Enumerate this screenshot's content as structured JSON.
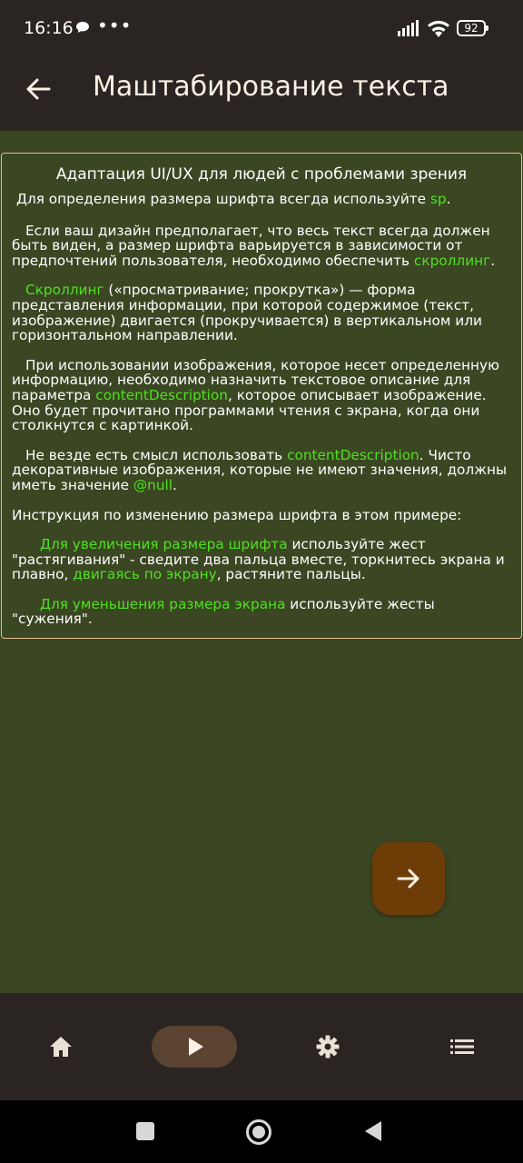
{
  "status_bar": {
    "time": "16:16",
    "dots": "•••",
    "battery": "92"
  },
  "app_bar": {
    "title": "Маштабирование текста"
  },
  "card": {
    "title": "Адаптация UI/UX для людей с проблемами зрения",
    "p1": {
      "text": "Для определения размера шрифта всегда используйте ",
      "hl": "sp",
      "end": "."
    },
    "p2": {
      "text": "Если ваш дизайн предполагает, что весь текст всегда должен быть виден, а размер шрифта варьируется в зависимости от предпочтений пользователя, необходимо обеспечить ",
      "hl": "скроллинг",
      "end": "."
    },
    "p3": {
      "hl": "Скроллинг",
      "text": " («просматривание; прокрутка») — форма представления информации, при которой содержимое (текст, изображение) двигается (прокручивается) в вертикальном или горизонтальном направлении."
    },
    "p4": {
      "text": "При использовании изображения, которое несет определенную информацию, необходимо назначить текстовое описание для параметра ",
      "hl": "contentDescription",
      "end": ", которое описывает изображение. Оно будет прочитано программами чтения с экрана, когда они столкнутся с картинкой."
    },
    "p5": {
      "text": "Не везде есть смысл использовать ",
      "hl": "contentDescription",
      "mid": ". Чисто декоративные изображения, которые не имеют значения, должны иметь значение ",
      "hl2": "@null",
      "end": "."
    },
    "p6": {
      "text": "Инструкция по изменению размера шрифта в этом примере:"
    },
    "p7": {
      "hl": "Для увеличения размера шрифта",
      "text": " используйте жест \"растягивания\" - сведите два пальца вместе, торкнитесь экрана и плавно, ",
      "hl2": "двигаясь по экрану",
      "end": ", растяните пальцы."
    },
    "p8": {
      "hl": "Для уменьшения размера экрана",
      "text": " используйте жесты \"сужения\"."
    }
  },
  "fab": {
    "icon": "arrow-forward-icon"
  },
  "bottom_nav": {
    "items": [
      {
        "icon": "home-icon",
        "active": false
      },
      {
        "icon": "play-icon",
        "active": true
      },
      {
        "icon": "settings-icon",
        "active": false
      },
      {
        "icon": "list-icon",
        "active": false
      }
    ]
  },
  "colors": {
    "background": "#3b4723",
    "bar": "#2a2522",
    "highlight": "#4ee021",
    "fab": "#6e3d07",
    "nav_active": "#5a4331",
    "card_border": "#e7bc8a"
  }
}
